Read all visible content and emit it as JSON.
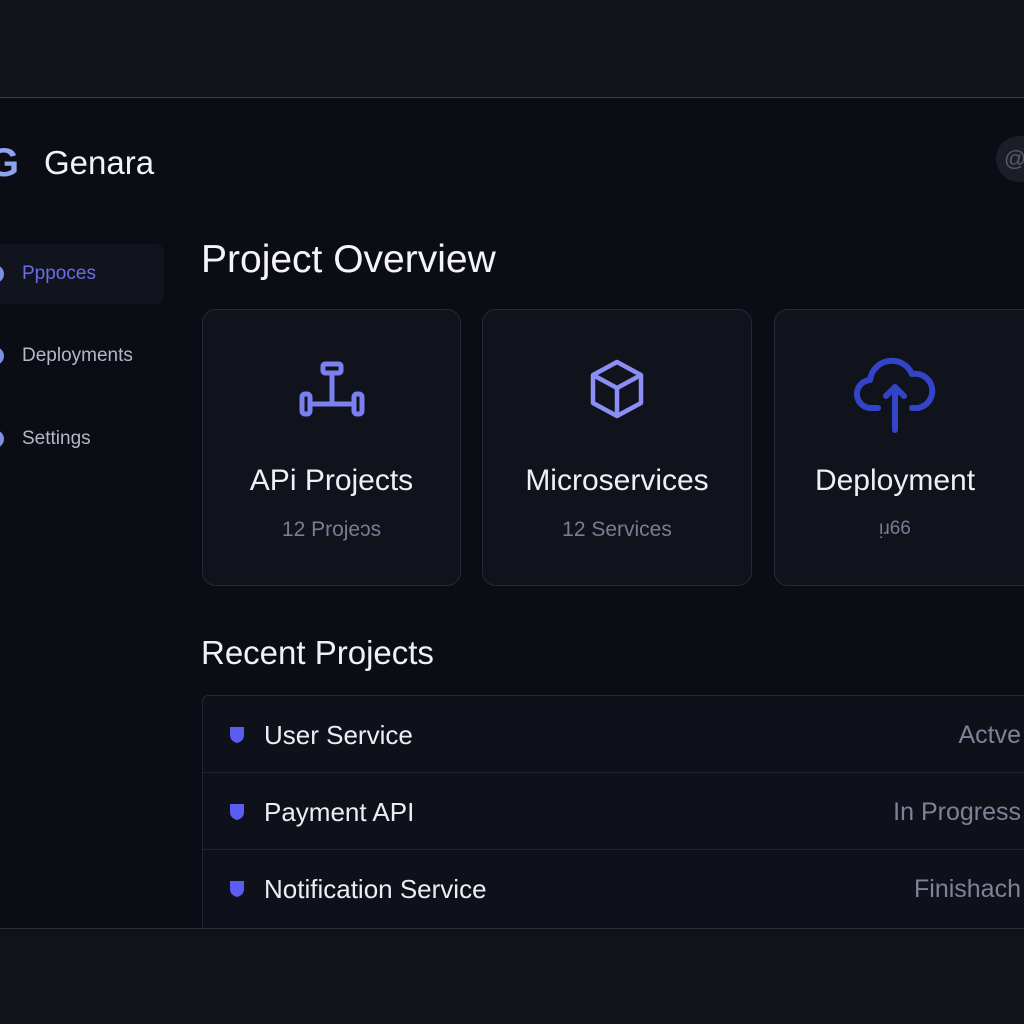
{
  "brand": {
    "logo_letter": "G",
    "name": "Genara"
  },
  "header": {
    "action_icon": "at-icon",
    "action_glyph": "@"
  },
  "sidebar": {
    "items": [
      {
        "label": "Pppoces",
        "active": true
      },
      {
        "label": "Deployments",
        "active": false
      },
      {
        "label": "Settings",
        "active": false
      }
    ]
  },
  "overview": {
    "title": "Project Overview",
    "cards": [
      {
        "icon": "api-connector-icon",
        "title": "APi Projects",
        "subtitle": "12 Projeɔs"
      },
      {
        "icon": "cube-icon",
        "title": "Microservices",
        "subtitle": "12 Services"
      },
      {
        "icon": "cloud-upload-icon",
        "title": "Deployment",
        "subtitle": "ᴉɹ66"
      }
    ]
  },
  "recent": {
    "title": "Recent Projects",
    "rows": [
      {
        "name": "User Service",
        "status": "Actve"
      },
      {
        "name": "Payment API",
        "status": "In Progress"
      },
      {
        "name": "Notification Service",
        "status": "Finishach"
      }
    ]
  },
  "colors": {
    "background": "#0b0c14",
    "accent": "#6a6ce8",
    "icon_purple": "#7b7ff0",
    "icon_blue": "#3344c8",
    "muted_text": "#787d92"
  }
}
